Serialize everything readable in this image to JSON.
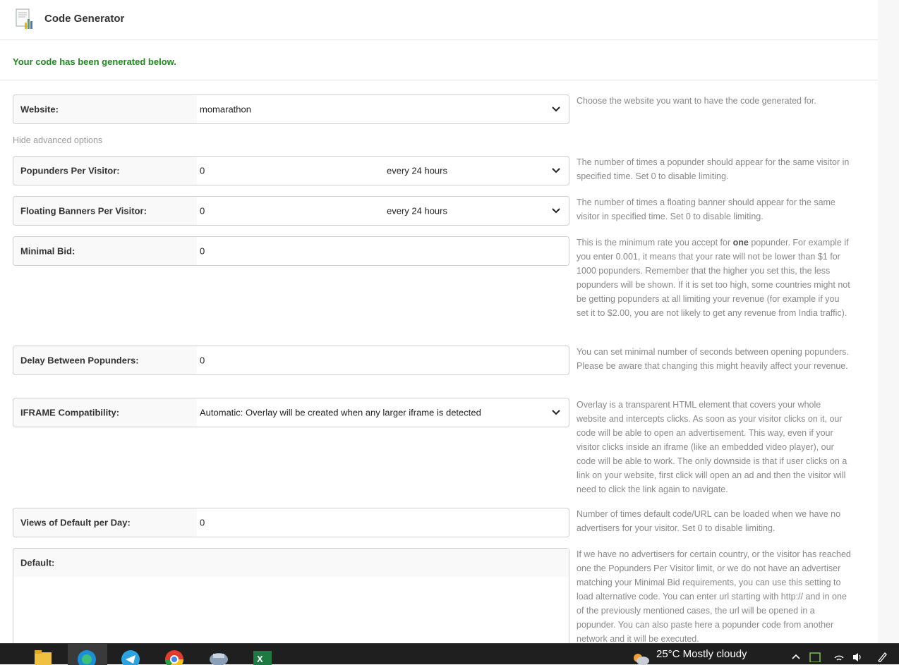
{
  "header": {
    "title": "Code Generator",
    "logo_icon": "report-chart-icon"
  },
  "notice": "Your code has been generated below.",
  "advanced_toggle": "Hide advanced options",
  "fields": {
    "website": {
      "label": "Website:",
      "value": "momarathon",
      "help": "Choose the website you want to have the code generated for."
    },
    "popunders": {
      "label": "Popunders Per Visitor:",
      "value": "0",
      "period": "every 24 hours",
      "help": "The number of times a popunder should appear for the same visitor in specified time. Set 0 to disable limiting."
    },
    "banners": {
      "label": "Floating Banners Per Visitor:",
      "value": "0",
      "period": "every 24 hours",
      "help": "The number of times a floating banner should appear for the same visitor in specified time. Set 0 to disable limiting."
    },
    "minbid": {
      "label": "Minimal Bid:",
      "value": "0",
      "help_pre": "This is the minimum rate you accept for ",
      "help_bold": "one",
      "help_post": " popunder. For example if you enter 0.001, it means that your rate will not be lower than $1 for 1000 popunders. Remember that the higher you set this, the less popunders will be shown. If it is set too high, some countries might not be getting popunders at all limiting your revenue (for example if you set it to $2.00, you are not likely to get any revenue from India traffic)."
    },
    "delay": {
      "label": "Delay Between Popunders:",
      "value": "0",
      "help": "You can set minimal number of seconds between opening popunders. Please be aware that changing this might heavily affect your revenue."
    },
    "iframe": {
      "label": "IFRAME Compatibility:",
      "value": "Automatic: Overlay will be created when any larger iframe is detected",
      "help": "Overlay is a transparent HTML element that covers your whole website and intercepts clicks. As soon as your visitor clicks on it, our code will be able to open an advertisement. This way, even if your visitor clicks inside an iframe (like an embedded video player), our code will be able to work. The only downside is that if user clicks on a link on your website, first click will open an ad and then the visitor will need to click the link again to navigate."
    },
    "views": {
      "label": "Views of Default per Day:",
      "value": "0",
      "help": "Number of times default code/URL can be loaded when we have no advertisers for your visitor. Set 0 to disable limiting."
    },
    "default": {
      "label": "Default:",
      "value": "",
      "help": "If we have no advertisers for certain country, or the visitor has reached one the Popunders Per Visitor limit, or we do not have an advertiser matching your Minimal Bid requirements, you can use this setting to load alternative code. You can enter url starting with http:// and in one of the previously mentioned cases, the url will be opened in a popunder. You can also paste here a popunder code from another network and it will be executed."
    }
  },
  "taskbar": {
    "apps": [
      "file-explorer-icon",
      "edge-icon",
      "telegram-icon",
      "chrome-icon",
      "network-app-icon",
      "excel-icon"
    ],
    "weather": "25°C  Mostly cloudy",
    "tray": [
      "chevron-up-icon",
      "tray-app-icon",
      "wifi-icon",
      "volume-icon",
      "pen-icon"
    ]
  },
  "colors": {
    "notice": "#1c8a1c",
    "help_text": "#888888",
    "taskbar": "#1f1f1f"
  }
}
